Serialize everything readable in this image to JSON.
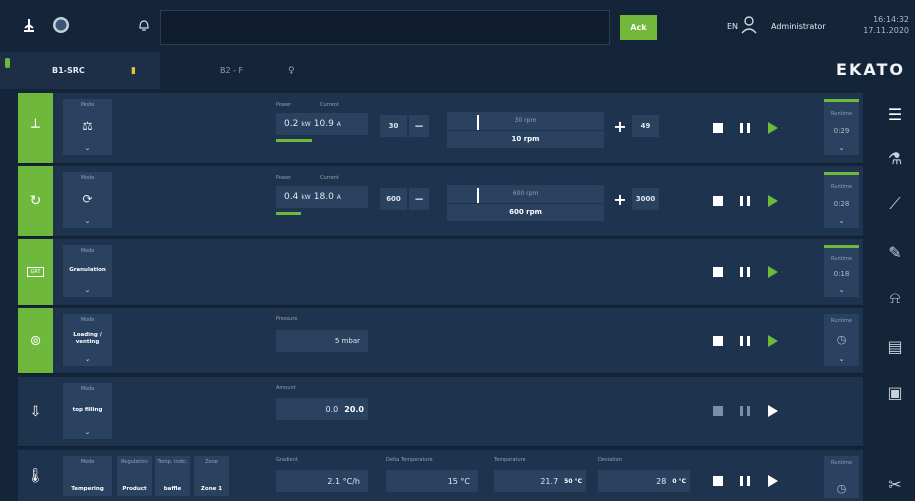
{
  "header": {
    "ack_label": "Ack",
    "language": "EN",
    "user": "Administrator",
    "time": "16:14:32",
    "date": "17.11.2020",
    "brand_logo": "EKATO"
  },
  "tabs": [
    {
      "label": "B1-SRC"
    },
    {
      "label": "B2 - F"
    }
  ],
  "rows": {
    "agitator": {
      "mode_label": "Mode",
      "power_label": "Power",
      "current_label": "Current",
      "power_value": "0.2",
      "power_unit": "kW",
      "current_value": "10.9",
      "current_unit": "A",
      "min_value": "30",
      "max_value": "49",
      "speed_actual": "30 rpm",
      "speed_setpoint": "10 rpm",
      "runtime_label": "Runtime",
      "runtime_value": "0:29"
    },
    "pump": {
      "mode_label": "Mode",
      "power_label": "Power",
      "current_label": "Current",
      "power_value": "0.4",
      "power_unit": "kW",
      "current_value": "18.0",
      "current_unit": "A",
      "min_value": "600",
      "max_value": "3000",
      "speed_actual": "600 rpm",
      "speed_setpoint": "600 rpm",
      "runtime_label": "Runtime",
      "runtime_value": "0:28"
    },
    "granulation": {
      "mode_label": "Mode",
      "mode_value": "Granulation",
      "runtime_label": "Runtime",
      "runtime_value": "0:18"
    },
    "loading": {
      "mode_label": "Mode",
      "mode_value": "Loading / venting",
      "pressure_label": "Pressure",
      "pressure_value": "5 mbar",
      "runtime_label": "Runtime"
    },
    "topfilling": {
      "mode_label": "Mode",
      "mode_value": "top filling",
      "amount_label": "Amount",
      "amount_actual": "0.0",
      "amount_setpoint": "20.0"
    },
    "tempering": {
      "mode_label": "Mode",
      "mode_value": "Tempering",
      "regulation_label": "Regulation",
      "regulation_value": "Product",
      "temp_indic_label": "Temp. indic.",
      "temp_indic_value": "baffle",
      "zone_label": "Zone",
      "zone_value": "Zone 1",
      "gradient_label": "Gradient",
      "gradient_value": "2.1 °C/h",
      "delta_label": "Delta Temperature",
      "delta_value": "15 °C",
      "temp_label": "Temperature",
      "temp_actual": "21.7",
      "temp_setpoint": "50 °C",
      "deviation_label": "Deviation",
      "deviation_actual": "28",
      "deviation_setpoint": "0 °C",
      "runtime_label": "Runtime"
    }
  },
  "colors": {
    "green": "#6eb83c",
    "background": "#14253a",
    "row": "#1e334d",
    "panel": "#2a4260"
  }
}
